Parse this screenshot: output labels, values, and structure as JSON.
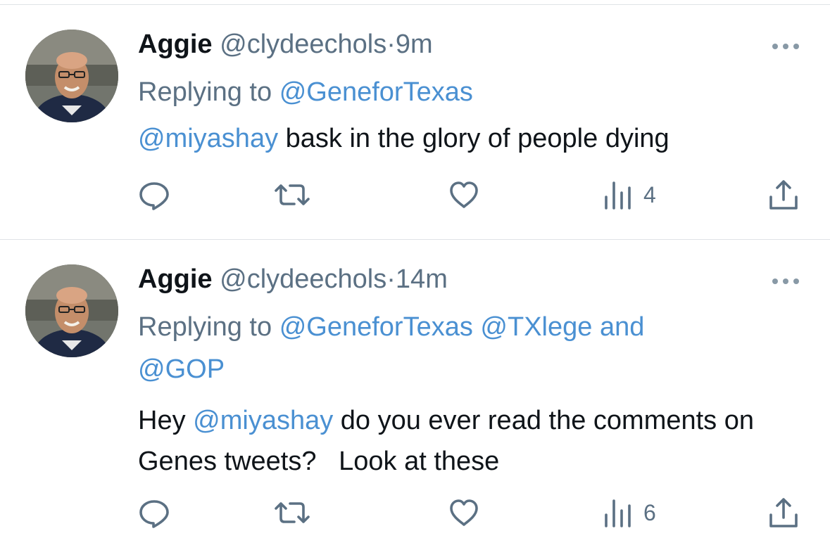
{
  "tweets": [
    {
      "name": "Aggie",
      "handle": "@clydeechols",
      "separator": "·",
      "time": "9m",
      "replying_prefix": "Replying to",
      "replying_to": [
        "@GeneforTexas"
      ],
      "body_mention": "@miyashay",
      "body_text": " bask in the glory of people dying",
      "views": "4"
    },
    {
      "name": "Aggie",
      "handle": "@clydeechols",
      "separator": "·",
      "time": "14m",
      "replying_prefix": "Replying to",
      "replying_to": [
        "@GeneforTexas",
        "@TXlege",
        "and",
        "@GOP"
      ],
      "body_prefix": "Hey ",
      "body_mention": "@miyashay",
      "body_text": " do you ever read the comments on Genes tweets?   Look at these",
      "views": "6"
    }
  ],
  "icons": {
    "reply": "reply-icon",
    "retweet": "retweet-icon",
    "like": "heart-icon",
    "views": "views-icon",
    "share": "share-icon",
    "more": "more-icon"
  },
  "colors": {
    "text": "#0f1419",
    "secondary": "#5b7083",
    "link": "#4a90d2",
    "divider": "#dfe3e6"
  }
}
